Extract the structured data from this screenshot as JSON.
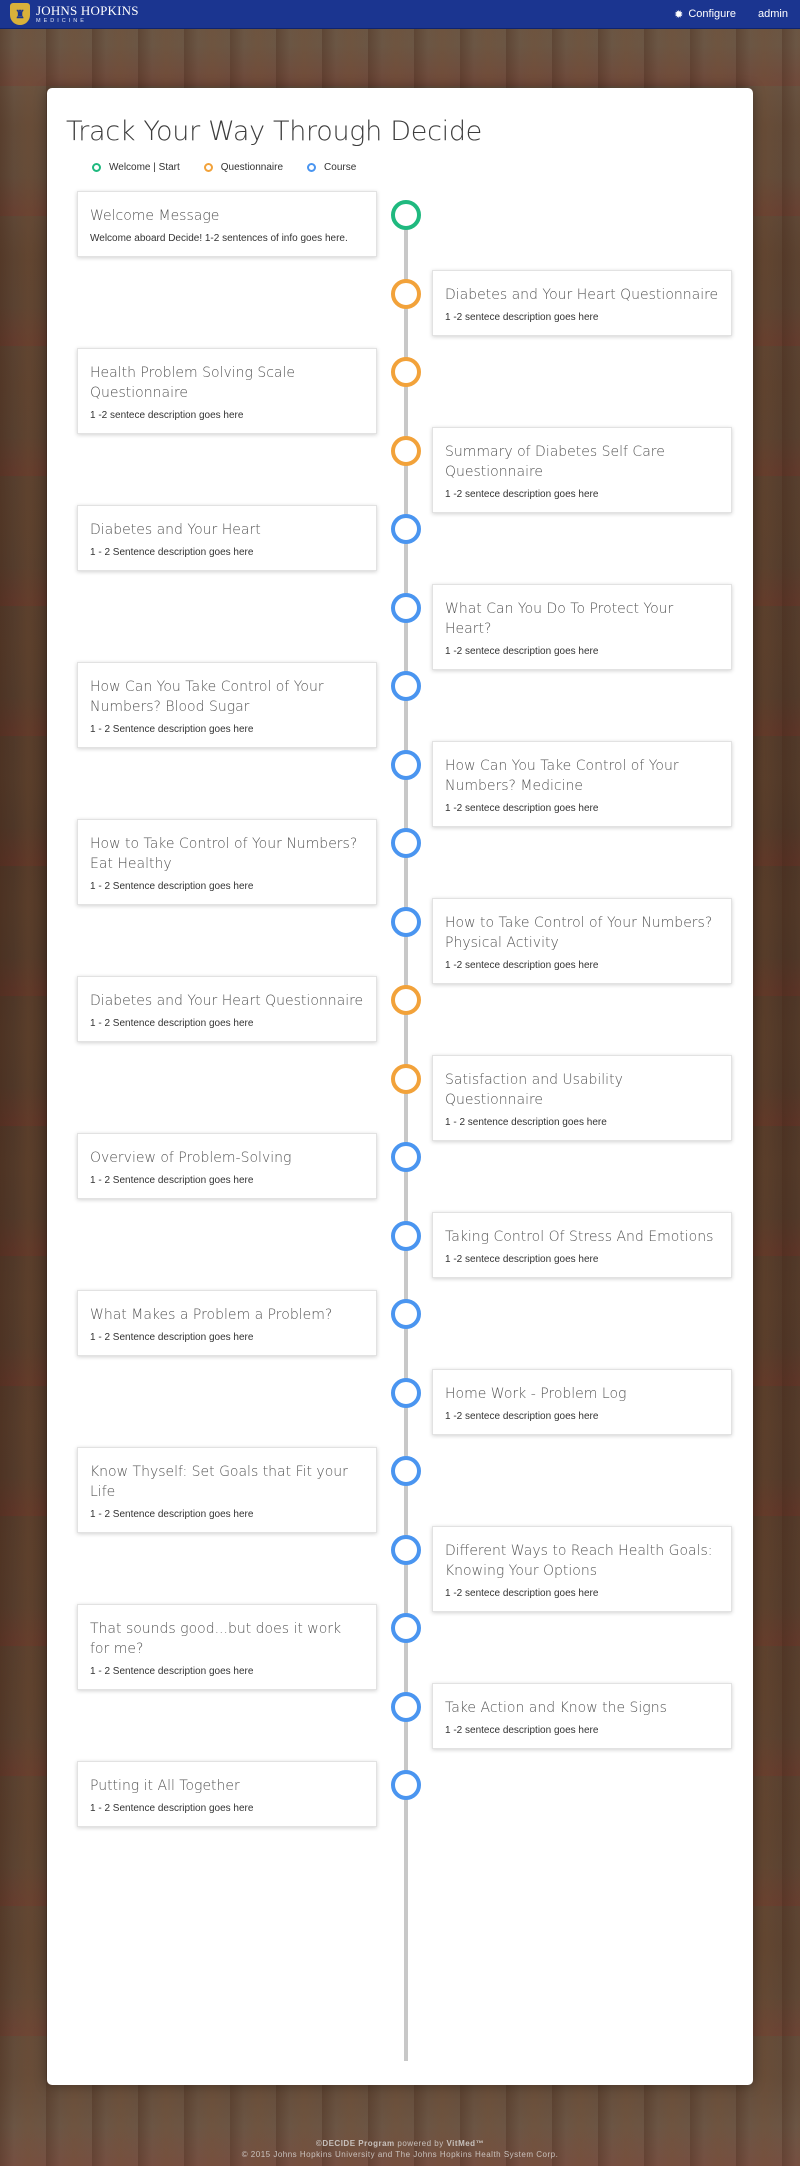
{
  "header": {
    "logo_main": "JOHNS HOPKINS",
    "logo_sub": "MEDICINE",
    "configure_label": "Configure",
    "user_label": "admin"
  },
  "page": {
    "title": "Track Your Way Through Decide"
  },
  "legend": [
    {
      "label": "Welcome | Start",
      "color": "#1fb97f"
    },
    {
      "label": "Questionnaire",
      "color": "#f2a23a"
    },
    {
      "label": "Course",
      "color": "#4a95f0"
    }
  ],
  "colors": {
    "welcome": "#1fb97f",
    "questionnaire": "#f2a23a",
    "course": "#4a95f0",
    "header_bg": "#1b3590"
  },
  "timeline": [
    {
      "side": "left",
      "type": "welcome",
      "title": "Welcome Message",
      "desc": "Welcome aboard Decide! 1-2 sentences of info goes here."
    },
    {
      "side": "right",
      "type": "questionnaire",
      "title": "Diabetes and Your Heart Questionnaire",
      "desc": "1 -2 sentece description goes here"
    },
    {
      "side": "left",
      "type": "questionnaire",
      "title": "Health Problem Solving Scale Questionnaire",
      "desc": "1 -2 sentece description goes here"
    },
    {
      "side": "right",
      "type": "questionnaire",
      "title": "Summary of Diabetes Self Care Questionnaire",
      "desc": "1 -2 sentece description goes here"
    },
    {
      "side": "left",
      "type": "course",
      "title": "Diabetes and Your Heart",
      "desc": "1 - 2 Sentence description goes here"
    },
    {
      "side": "right",
      "type": "course",
      "title": "What Can You Do To Protect Your Heart?",
      "desc": "1 -2 sentece description goes here"
    },
    {
      "side": "left",
      "type": "course",
      "title": "How Can You Take Control of Your Numbers? Blood Sugar",
      "desc": "1 - 2 Sentence description goes here"
    },
    {
      "side": "right",
      "type": "course",
      "title": "How Can You Take Control of Your Numbers? Medicine",
      "desc": "1 -2 sentece description goes here"
    },
    {
      "side": "left",
      "type": "course",
      "title": "How to Take Control of Your Numbers? Eat Healthy",
      "desc": "1 - 2 Sentence description goes here"
    },
    {
      "side": "right",
      "type": "course",
      "title": "How to Take Control of Your Numbers? Physical Activity",
      "desc": "1 -2 sentece description goes here"
    },
    {
      "side": "left",
      "type": "questionnaire",
      "title": "Diabetes and Your Heart Questionnaire",
      "desc": "1 - 2 Sentence description goes here"
    },
    {
      "side": "right",
      "type": "questionnaire",
      "title": "Satisfaction and Usability Questionnaire",
      "desc": "1 - 2 sentence description goes here"
    },
    {
      "side": "left",
      "type": "course",
      "title": "Overview of Problem-Solving",
      "desc": "1 - 2 Sentence description goes here"
    },
    {
      "side": "right",
      "type": "course",
      "title": "Taking Control Of Stress And Emotions",
      "desc": "1 -2 sentece description goes here"
    },
    {
      "side": "left",
      "type": "course",
      "title": "What Makes a Problem a Problem?",
      "desc": "1 - 2 Sentence description goes here"
    },
    {
      "side": "right",
      "type": "course",
      "title": "Home Work - Problem Log",
      "desc": "1 -2 sentece description goes here"
    },
    {
      "side": "left",
      "type": "course",
      "title": "Know Thyself: Set Goals that Fit your Life",
      "desc": "1 - 2 Sentence description goes here"
    },
    {
      "side": "right",
      "type": "course",
      "title": "Different Ways to Reach Health Goals: Knowing Your Options",
      "desc": "1 -2 sentece description goes here"
    },
    {
      "side": "left",
      "type": "course",
      "title": "That sounds good...but does it work for me?",
      "desc": "1 - 2 Sentence description goes here"
    },
    {
      "side": "right",
      "type": "course",
      "title": "Take Action and Know the Signs",
      "desc": "1 -2 sentece description goes here"
    },
    {
      "side": "left",
      "type": "course",
      "title": "Putting it All Together",
      "desc": "1 - 2 Sentence description goes here"
    }
  ],
  "footer": {
    "line1_brand": "©DECIDE Program",
    "line1_mid": " powered by ",
    "line1_vendor": "VitMed™",
    "line2": "© 2015 Johns Hopkins University and The Johns Hopkins Health System Corp."
  }
}
